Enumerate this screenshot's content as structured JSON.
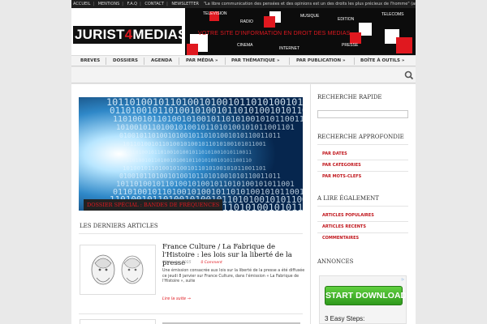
{
  "topbar": {
    "links": [
      "ACCUEIL",
      "MENTIONS",
      "F.A.Q",
      "CONTACT",
      "NEWSLETTER"
    ],
    "quote": "\"La libre communication des pensées et des opinions est un des droits les plus précieux de l'homme\" (art. 11 DDHC)"
  },
  "header": {
    "logo_part1": "JURIST",
    "logo_part2": "4",
    "logo_part3": "MEDIAS",
    "banner_words": [
      "TELEVISION",
      "RADIO",
      "MUSIQUE",
      "EDITION",
      "TELECOMS",
      "CINEMA",
      "INTERNET",
      "PRESSE"
    ],
    "slogan": "VOTRE SITE D'INFORMATION EN DROIT DES MEDIAS"
  },
  "nav": {
    "items": [
      "BREVES",
      "DOSSIERS",
      "AGENDA",
      "PAR MÉDIA »",
      "PAR THÉMATIQUE »",
      "PAR PUBLICATION »",
      "BOÎTE À OUTILS »"
    ],
    "search_icon": "search-icon"
  },
  "feature": {
    "caption": "DOSSIER SPÉCIAL : BANDES DE FRÉQUENCES"
  },
  "latest": {
    "heading": "LES DERNIERS ARTICLES",
    "article": {
      "title": "France Culture / La Fabrique de l'Histoire : les lois sur la liberté de la presse",
      "date": "09 janvier 2015",
      "comments": "0 Comment",
      "body": "Une émission consacrée aux lois sur la liberté de la presse a été diffusée ce jeudi 8 janvier sur France Culture, dans l'émission « La Fabrique de l'Histoire », suite",
      "readmore": "Lire la suite →"
    }
  },
  "sidebar": {
    "quick_search": "RECHERCHE RAPIDE",
    "advanced_search": "RECHERCHE APPROFONDIE",
    "advanced_links": [
      "PAR DATES",
      "PAR CATEGORIES",
      "PAR MOTS-CLEFS"
    ],
    "also_read": "A LIRE ÉGALEMENT",
    "also_links": [
      "ARTICLES POPULAIRES",
      "ARTICLES RECENTS",
      "COMMENTAIRES"
    ],
    "ads_title": "ANNONCES",
    "ad_button": "START DOWNLOAD",
    "ad_steps": "3 Easy Steps:"
  },
  "colors": {
    "accent": "#e0181f",
    "dark": "#0c0c0c"
  }
}
